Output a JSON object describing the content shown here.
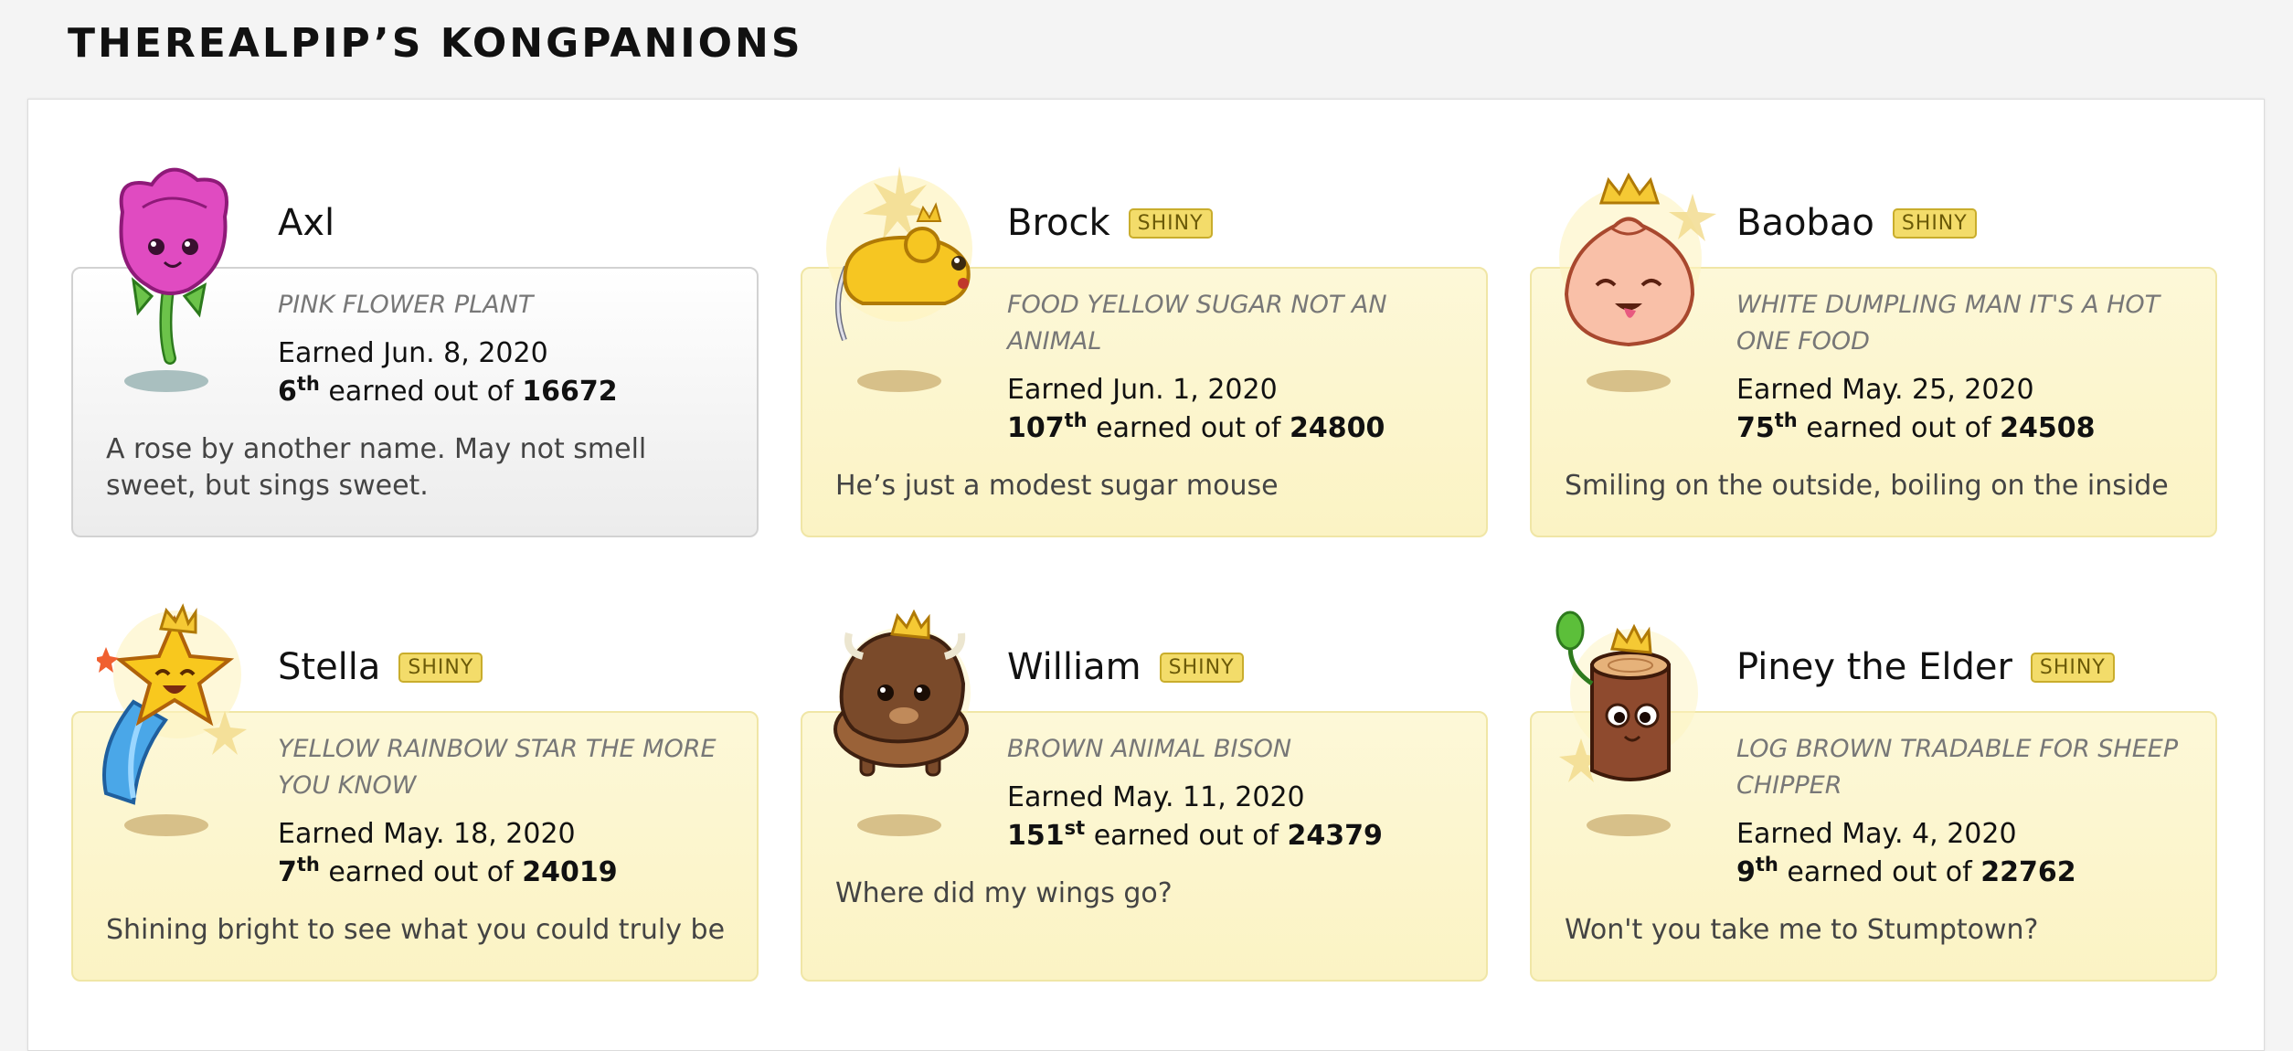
{
  "page": {
    "title": "THEREALPIP’S KONGPANIONS"
  },
  "shiny_label": "SHINY",
  "earned_prefix": "Earned",
  "earned_out_of": "earned out of",
  "cards": [
    {
      "name": "Axl",
      "shiny": false,
      "tags": "PINK FLOWER PLANT",
      "earned_date": "Jun. 8, 2020",
      "rank": "6",
      "rank_suffix": "th",
      "total": "16672",
      "description": "A rose by another name. May not smell sweet, but sings sweet.",
      "icon": "rose-icon"
    },
    {
      "name": "Brock",
      "shiny": true,
      "tags": "FOOD YELLOW SUGAR NOT AN ANIMAL",
      "earned_date": "Jun. 1, 2020",
      "rank": "107",
      "rank_suffix": "th",
      "total": "24800",
      "description": "He’s just a modest sugar mouse",
      "icon": "sugar-mouse-icon"
    },
    {
      "name": "Baobao",
      "shiny": true,
      "tags": "WHITE DUMPLING MAN IT'S A HOT ONE FOOD",
      "earned_date": "May. 25, 2020",
      "rank": "75",
      "rank_suffix": "th",
      "total": "24508",
      "description": "Smiling on the outside, boiling on the inside",
      "icon": "dumpling-icon"
    },
    {
      "name": "Stella",
      "shiny": true,
      "tags": "YELLOW RAINBOW STAR THE MORE YOU KNOW",
      "earned_date": "May. 18, 2020",
      "rank": "7",
      "rank_suffix": "th",
      "total": "24019",
      "description": "Shining bright to see what you could truly be",
      "icon": "shooting-star-icon"
    },
    {
      "name": "William",
      "shiny": true,
      "tags": "BROWN ANIMAL BISON",
      "earned_date": "May. 11, 2020",
      "rank": "151",
      "rank_suffix": "st",
      "total": "24379",
      "description": "Where did my wings go?",
      "icon": "bison-icon"
    },
    {
      "name": "Piney the Elder",
      "shiny": true,
      "tags": "LOG BROWN TRADABLE FOR SHEEP CHIPPER",
      "earned_date": "May. 4, 2020",
      "rank": "9",
      "rank_suffix": "th",
      "total": "22762",
      "description": "Won't you take me to Stumptown?",
      "icon": "log-stump-icon"
    }
  ]
}
